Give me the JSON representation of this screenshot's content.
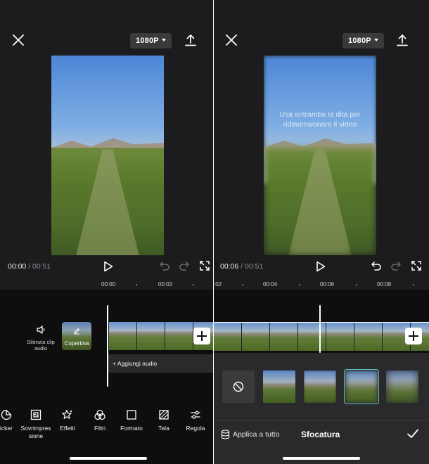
{
  "left": {
    "resolution": "1080P",
    "time_current": "00:00",
    "time_separator": "/",
    "time_total": "00:51",
    "ruler": {
      "a": "00:00",
      "b": "00:02"
    },
    "mute_label": "Silenzia clip audio",
    "cover_label": "Copertina",
    "add_audio_label": "Aggiungi audio",
    "tools": [
      {
        "label": "icker",
        "icon": "sticker-icon"
      },
      {
        "label": "Sovrimpres\nsione",
        "icon": "overlay-icon"
      },
      {
        "label": "Effetti",
        "icon": "effects-icon"
      },
      {
        "label": "Filtri",
        "icon": "filters-icon"
      },
      {
        "label": "Formato",
        "icon": "format-icon"
      },
      {
        "label": "Tela",
        "icon": "canvas-icon"
      },
      {
        "label": "Regola",
        "icon": "adjust-icon"
      }
    ]
  },
  "right": {
    "resolution": "1080P",
    "hint": "Usa entrambe le dita per ridimensionare il video",
    "time_current": "00:06",
    "time_separator": "/",
    "time_total": "00:51",
    "ruler": {
      "a": ":02",
      "b": "00:04",
      "c": "00:06",
      "d": "00:08"
    },
    "apply_all": "Applica a tutto",
    "panel_title": "Sfocatura"
  },
  "colors": {
    "bg": "#1c1c1e",
    "band": "#0e0e0e",
    "panel": "#2a2a2c",
    "accent": "#63c6c0"
  }
}
